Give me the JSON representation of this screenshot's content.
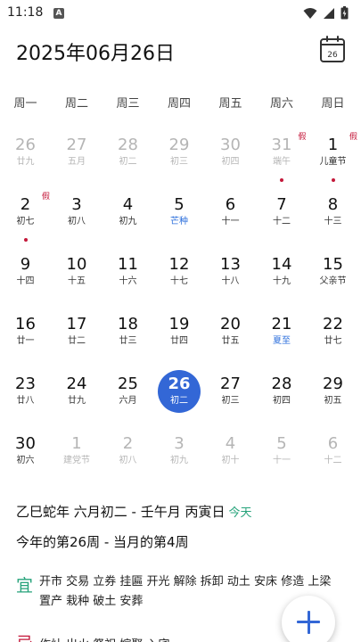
{
  "status_bar": {
    "time": "11:18",
    "app_icon_letter": "A"
  },
  "header": {
    "date_title": "2025年06月26日",
    "calendar_icon_day": "26"
  },
  "weekdays": [
    "周一",
    "周二",
    "周三",
    "周四",
    "周五",
    "周六",
    "周日"
  ],
  "colors": {
    "accent": "#3367d6",
    "term": "#2c6fdc",
    "holiday": "#c4183a",
    "yi": "#27a37b",
    "faded": "#b5b5b5"
  },
  "weeks": [
    [
      {
        "day": "26",
        "lunar": "廿九",
        "faded": true
      },
      {
        "day": "27",
        "lunar": "五月",
        "faded": true
      },
      {
        "day": "28",
        "lunar": "初二",
        "faded": true
      },
      {
        "day": "29",
        "lunar": "初三",
        "faded": true
      },
      {
        "day": "30",
        "lunar": "初四",
        "faded": true
      },
      {
        "day": "31",
        "lunar": "端午",
        "faded": true,
        "badge": "假",
        "dot": true
      },
      {
        "day": "1",
        "lunar": "儿童节",
        "badge": "假",
        "dot": true
      }
    ],
    [
      {
        "day": "2",
        "lunar": "初七",
        "badge": "假",
        "dot": true
      },
      {
        "day": "3",
        "lunar": "初八"
      },
      {
        "day": "4",
        "lunar": "初九"
      },
      {
        "day": "5",
        "lunar": "芒种",
        "term": true
      },
      {
        "day": "6",
        "lunar": "十一"
      },
      {
        "day": "7",
        "lunar": "十二"
      },
      {
        "day": "8",
        "lunar": "十三"
      }
    ],
    [
      {
        "day": "9",
        "lunar": "十四"
      },
      {
        "day": "10",
        "lunar": "十五"
      },
      {
        "day": "11",
        "lunar": "十六"
      },
      {
        "day": "12",
        "lunar": "十七"
      },
      {
        "day": "13",
        "lunar": "十八"
      },
      {
        "day": "14",
        "lunar": "十九"
      },
      {
        "day": "15",
        "lunar": "父亲节"
      }
    ],
    [
      {
        "day": "16",
        "lunar": "廿一"
      },
      {
        "day": "17",
        "lunar": "廿二"
      },
      {
        "day": "18",
        "lunar": "廿三"
      },
      {
        "day": "19",
        "lunar": "廿四"
      },
      {
        "day": "20",
        "lunar": "廿五"
      },
      {
        "day": "21",
        "lunar": "夏至",
        "term": true
      },
      {
        "day": "22",
        "lunar": "廿七"
      }
    ],
    [
      {
        "day": "23",
        "lunar": "廿八"
      },
      {
        "day": "24",
        "lunar": "廿九"
      },
      {
        "day": "25",
        "lunar": "六月"
      },
      {
        "day": "26",
        "lunar": "初二",
        "selected": true
      },
      {
        "day": "27",
        "lunar": "初三"
      },
      {
        "day": "28",
        "lunar": "初四"
      },
      {
        "day": "29",
        "lunar": "初五"
      }
    ],
    [
      {
        "day": "30",
        "lunar": "初六"
      },
      {
        "day": "1",
        "lunar": "建党节",
        "faded": true
      },
      {
        "day": "2",
        "lunar": "初八",
        "faded": true
      },
      {
        "day": "3",
        "lunar": "初九",
        "faded": true
      },
      {
        "day": "4",
        "lunar": "初十",
        "faded": true
      },
      {
        "day": "5",
        "lunar": "十一",
        "faded": true
      },
      {
        "day": "6",
        "lunar": "十二",
        "faded": true
      }
    ]
  ],
  "info": {
    "lunar_line": "乙巳蛇年 六月初二 - 壬午月 丙寅日",
    "today_label": "今天",
    "week_line": "今年的第26周 - 当月的第4周"
  },
  "almanac": {
    "yi_label": "宜",
    "yi_text": "开市 交易 立券 挂匾 开光 解除 拆卸 动土 安床 修造 上梁 置产 栽种 破土 安葬",
    "ji_label": "忌",
    "ji_text": "作灶 出火 祭祀 嫁娶 入宅"
  }
}
